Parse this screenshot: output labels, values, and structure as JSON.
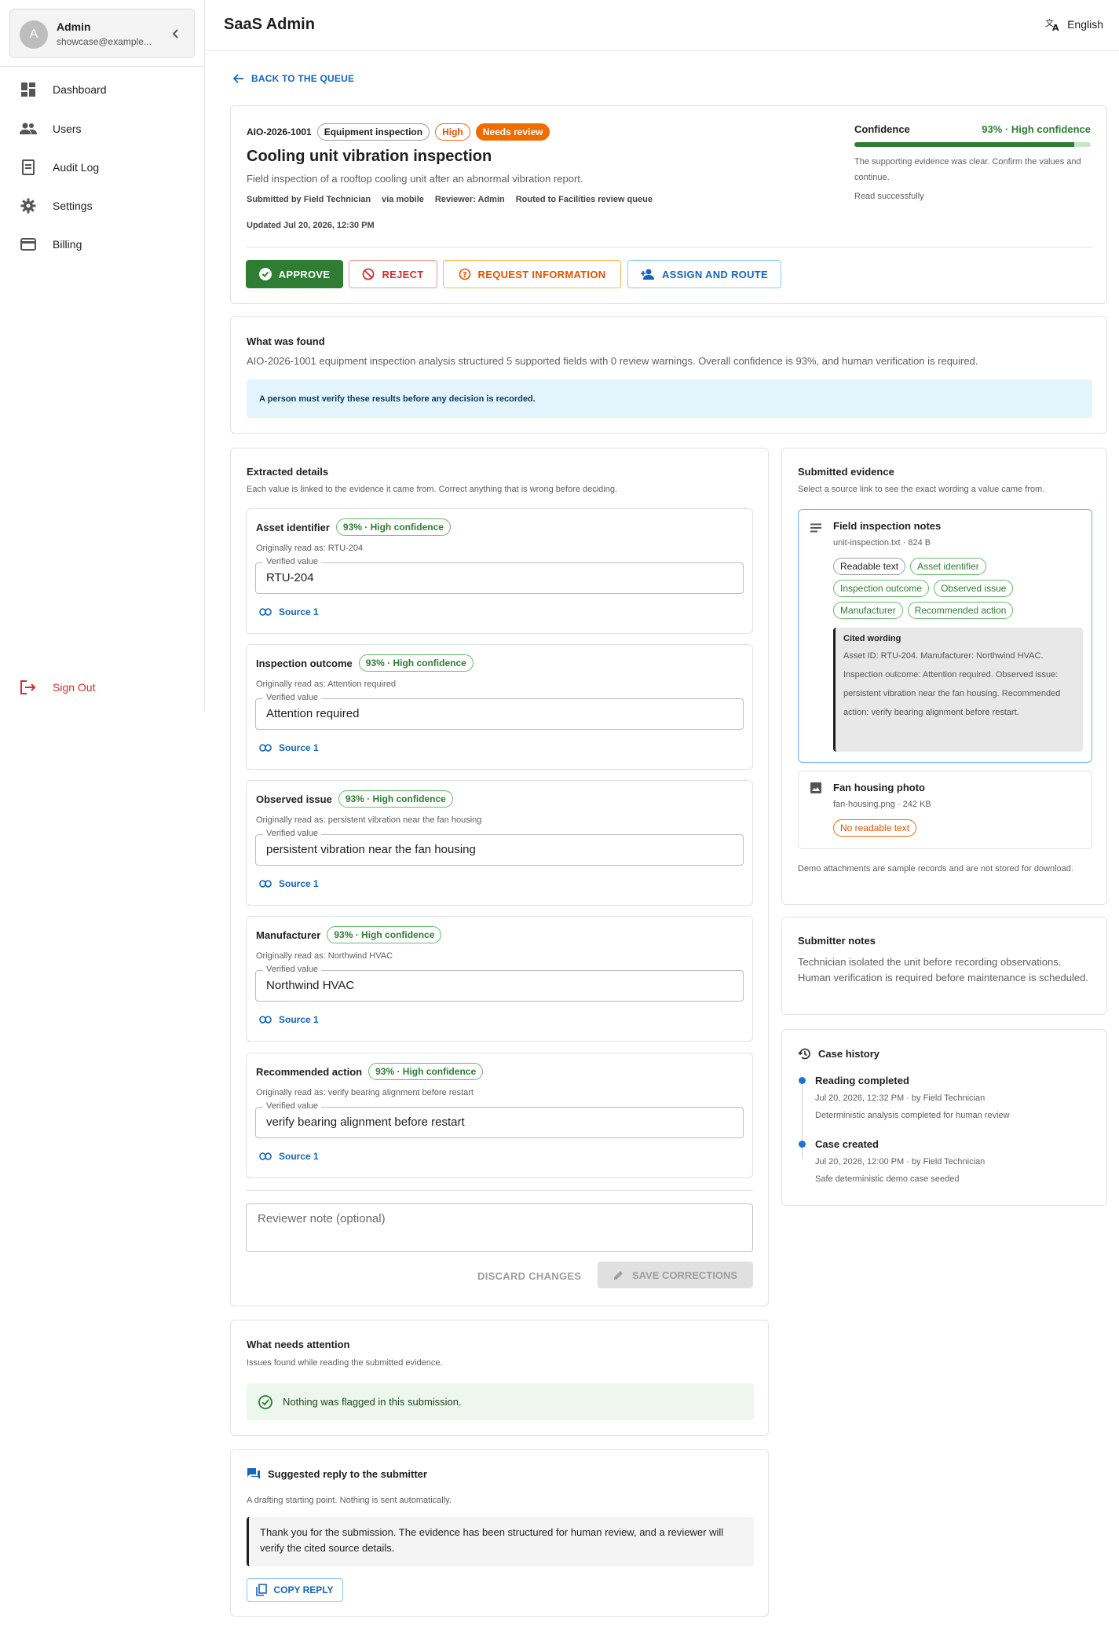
{
  "sidebar": {
    "user_initial": "A",
    "user_name": "Admin",
    "user_email": "showcase@example...",
    "items": [
      {
        "label": "Dashboard",
        "icon": "dashboard-icon"
      },
      {
        "label": "Users",
        "icon": "users-icon"
      },
      {
        "label": "Audit Log",
        "icon": "audit-log-icon"
      },
      {
        "label": "Settings",
        "icon": "gear-icon"
      },
      {
        "label": "Billing",
        "icon": "credit-card-icon"
      }
    ],
    "sign_out": "Sign Out"
  },
  "header": {
    "app_title": "SaaS Admin",
    "language": "English"
  },
  "back_link": "BACK TO THE QUEUE",
  "case": {
    "id": "AIO-2026-1001",
    "category": "Equipment inspection",
    "priority": "High",
    "status": "Needs review",
    "title": "Cooling unit vibration inspection",
    "description": "Field inspection of a rooftop cooling unit after an abnormal vibration report.",
    "submitted_by": "Submitted by Field Technician",
    "via": "via mobile",
    "reviewer": "Reviewer: Admin",
    "routed": "Routed to Facilities review queue",
    "updated": "Updated Jul 20, 2026, 12:30 PM",
    "confidence_label": "Confidence",
    "confidence_value": "93% · High confidence",
    "confidence_fraction": 0.93,
    "confidence_note": "The supporting evidence was clear. Confirm the values and continue.",
    "read_status": "Read successfully"
  },
  "actions": {
    "approve": "APPROVE",
    "reject": "REJECT",
    "request": "REQUEST INFORMATION",
    "assign": "ASSIGN AND ROUTE"
  },
  "found": {
    "title": "What was found",
    "summary": "AIO-2026-1001 equipment inspection analysis structured 5 supported fields with 0 review warnings. Overall confidence is 93%, and human verification is required.",
    "banner": "A person must verify these results before any decision is recorded."
  },
  "extracted": {
    "title": "Extracted details",
    "subtitle": "Each value is linked to the evidence it came from. Correct anything that is wrong before deciding.",
    "verified_label": "Verified value",
    "fields": [
      {
        "name": "Asset identifier",
        "confidence": "93% · High confidence",
        "original": "Originally read as: RTU-204",
        "value": "RTU-204",
        "source": "Source 1"
      },
      {
        "name": "Inspection outcome",
        "confidence": "93% · High confidence",
        "original": "Originally read as: Attention required",
        "value": "Attention required",
        "source": "Source 1"
      },
      {
        "name": "Observed issue",
        "confidence": "93% · High confidence",
        "original": "Originally read as: persistent vibration near the fan housing",
        "value": "persistent vibration near the fan housing",
        "source": "Source 1"
      },
      {
        "name": "Manufacturer",
        "confidence": "93% · High confidence",
        "original": "Originally read as: Northwind HVAC",
        "value": "Northwind HVAC",
        "source": "Source 1"
      },
      {
        "name": "Recommended action",
        "confidence": "93% · High confidence",
        "original": "Originally read as: verify bearing alignment before restart",
        "value": "verify bearing alignment before restart",
        "source": "Source 1"
      }
    ],
    "note_placeholder": "Reviewer note (optional)",
    "discard": "DISCARD CHANGES",
    "save": "SAVE CORRECTIONS"
  },
  "attention": {
    "title": "What needs attention",
    "subtitle": "Issues found while reading the submitted evidence.",
    "message": "Nothing was flagged in this submission."
  },
  "reply": {
    "title": "Suggested reply to the submitter",
    "subtitle": "A drafting starting point. Nothing is sent automatically.",
    "text": "Thank you for the submission. The evidence has been structured for human review, and a reviewer will verify the cited source details.",
    "copy": "COPY REPLY"
  },
  "evidence": {
    "title": "Submitted evidence",
    "subtitle": "Select a source link to see the exact wording a value came from.",
    "items": [
      {
        "name": "Field inspection notes",
        "file": "unit-inspection.txt · 824 B",
        "chips": [
          "Readable text",
          "Asset identifier",
          "Observed issue",
          "Inspection outcome",
          "Manufacturer",
          "Recommended action"
        ],
        "cited_label": "Cited wording",
        "cited_text": "Asset ID: RTU-204. Manufacturer: Northwind HVAC. Inspection outcome: Attention required. Observed issue: persistent vibration near the fan housing. Recommended action: verify bearing alignment before restart."
      },
      {
        "name": "Fan housing photo",
        "file": "fan-housing.png · 242 KB",
        "chips": [
          "No readable text"
        ]
      }
    ],
    "footnote": "Demo attachments are sample records and are not stored for download."
  },
  "submitter_notes": {
    "title": "Submitter notes",
    "text": "Technician isolated the unit before recording observations. Human verification is required before maintenance is scheduled."
  },
  "history": {
    "title": "Case history",
    "events": [
      {
        "title": "Reading completed",
        "meta": "Jul 20, 2026, 12:32 PM · by Field Technician",
        "detail": "Deterministic analysis completed for human review"
      },
      {
        "title": "Case created",
        "meta": "Jul 20, 2026, 12:00 PM · by Field Technician",
        "detail": "Safe deterministic demo case seeded"
      }
    ]
  },
  "colors": {
    "accent": "#1565c0",
    "success": "#2e7d32",
    "warning": "#ef6c00",
    "danger": "#d32f2f"
  }
}
